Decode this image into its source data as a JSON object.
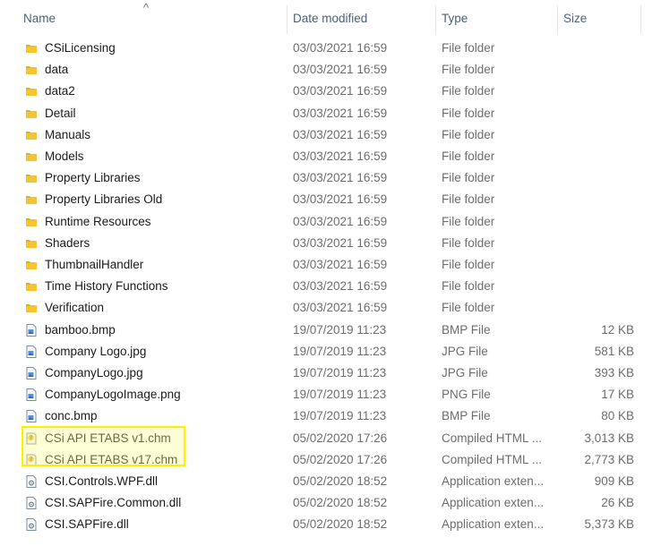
{
  "columns": {
    "name": "Name",
    "date": "Date modified",
    "type": "Type",
    "size": "Size"
  },
  "sort_indicator": "^",
  "files": [
    {
      "name": "CSiLicensing",
      "date": "03/03/2021 16:59",
      "type": "File folder",
      "size": "",
      "icon": "folder-icon"
    },
    {
      "name": "data",
      "date": "03/03/2021 16:59",
      "type": "File folder",
      "size": "",
      "icon": "folder-icon"
    },
    {
      "name": "data2",
      "date": "03/03/2021 16:59",
      "type": "File folder",
      "size": "",
      "icon": "folder-icon"
    },
    {
      "name": "Detail",
      "date": "03/03/2021 16:59",
      "type": "File folder",
      "size": "",
      "icon": "folder-icon"
    },
    {
      "name": "Manuals",
      "date": "03/03/2021 16:59",
      "type": "File folder",
      "size": "",
      "icon": "folder-icon"
    },
    {
      "name": "Models",
      "date": "03/03/2021 16:59",
      "type": "File folder",
      "size": "",
      "icon": "folder-icon"
    },
    {
      "name": "Property Libraries",
      "date": "03/03/2021 16:59",
      "type": "File folder",
      "size": "",
      "icon": "folder-icon"
    },
    {
      "name": "Property Libraries Old",
      "date": "03/03/2021 16:59",
      "type": "File folder",
      "size": "",
      "icon": "folder-icon"
    },
    {
      "name": "Runtime Resources",
      "date": "03/03/2021 16:59",
      "type": "File folder",
      "size": "",
      "icon": "folder-icon"
    },
    {
      "name": "Shaders",
      "date": "03/03/2021 16:59",
      "type": "File folder",
      "size": "",
      "icon": "folder-icon"
    },
    {
      "name": "ThumbnailHandler",
      "date": "03/03/2021 16:59",
      "type": "File folder",
      "size": "",
      "icon": "folder-icon"
    },
    {
      "name": "Time History Functions",
      "date": "03/03/2021 16:59",
      "type": "File folder",
      "size": "",
      "icon": "folder-icon"
    },
    {
      "name": "Verification",
      "date": "03/03/2021 16:59",
      "type": "File folder",
      "size": "",
      "icon": "folder-icon"
    },
    {
      "name": "bamboo.bmp",
      "date": "19/07/2019 11:23",
      "type": "BMP File",
      "size": "12 KB",
      "icon": "image-file-icon"
    },
    {
      "name": "Company Logo.jpg",
      "date": "19/07/2019 11:23",
      "type": "JPG File",
      "size": "581 KB",
      "icon": "image-file-icon"
    },
    {
      "name": "CompanyLogo.jpg",
      "date": "19/07/2019 11:23",
      "type": "JPG File",
      "size": "393 KB",
      "icon": "image-file-icon"
    },
    {
      "name": "CompanyLogoImage.png",
      "date": "19/07/2019 11:23",
      "type": "PNG File",
      "size": "17 KB",
      "icon": "image-file-icon"
    },
    {
      "name": "conc.bmp",
      "date": "19/07/2019 11:23",
      "type": "BMP File",
      "size": "80 KB",
      "icon": "image-file-icon"
    },
    {
      "name": "CSi API ETABS v1.chm",
      "date": "05/02/2020 17:26",
      "type": "Compiled HTML ...",
      "size": "3,013 KB",
      "icon": "chm-help-icon"
    },
    {
      "name": "CSi API ETABS v17.chm",
      "date": "05/02/2020 17:26",
      "type": "Compiled HTML ...",
      "size": "2,773 KB",
      "icon": "chm-help-icon"
    },
    {
      "name": "CSI.Controls.WPF.dll",
      "date": "05/02/2020 18:52",
      "type": "Application exten...",
      "size": "909 KB",
      "icon": "dll-file-icon"
    },
    {
      "name": "CSI.SAPFire.Common.dll",
      "date": "05/02/2020 18:52",
      "type": "Application exten...",
      "size": "26 KB",
      "icon": "dll-file-icon"
    },
    {
      "name": "CSI.SAPFire.dll",
      "date": "05/02/2020 18:52",
      "type": "Application exten...",
      "size": "5,373 KB",
      "icon": "dll-file-icon"
    }
  ],
  "colors": {
    "highlight_border": "#ffef00",
    "folder_yellow": "#f5c430",
    "header_text": "#4c607a"
  }
}
